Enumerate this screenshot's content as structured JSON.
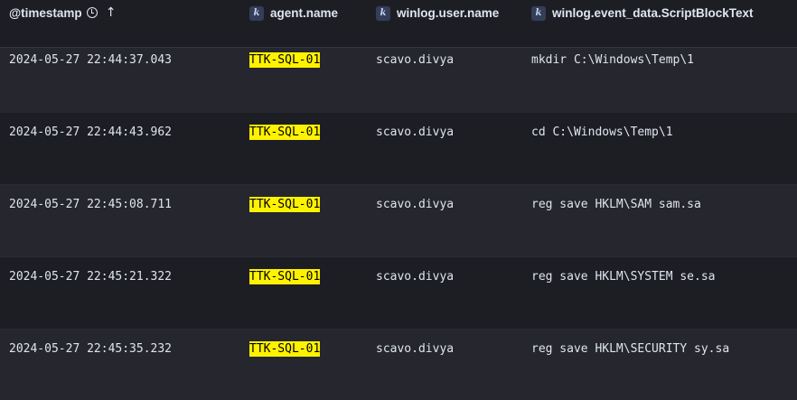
{
  "columns": {
    "timestamp": "@timestamp",
    "agent": "agent.name",
    "user": "winlog.user.name",
    "script": "winlog.event_data.ScriptBlockText",
    "field_type_badge": "k"
  },
  "icons": {
    "sort_time": "clock-icon",
    "sort_direction": "arrow-up-icon",
    "field_type": "keyword-badge"
  },
  "highlight_color": "#fff200",
  "rows": [
    {
      "timestamp": "2024-05-27 22:44:37.043",
      "agent": "TTK-SQL-01",
      "user": "scavo.divya",
      "script": "mkdir C:\\Windows\\Temp\\1"
    },
    {
      "timestamp": "2024-05-27 22:44:43.962",
      "agent": "TTK-SQL-01",
      "user": "scavo.divya",
      "script": "cd C:\\Windows\\Temp\\1"
    },
    {
      "timestamp": "2024-05-27 22:45:08.711",
      "agent": "TTK-SQL-01",
      "user": "scavo.divya",
      "script": "reg save HKLM\\SAM sam.sa"
    },
    {
      "timestamp": "2024-05-27 22:45:21.322",
      "agent": "TTK-SQL-01",
      "user": "scavo.divya",
      "script": "reg save HKLM\\SYSTEM se.sa"
    },
    {
      "timestamp": "2024-05-27 22:45:35.232",
      "agent": "TTK-SQL-01",
      "user": "scavo.divya",
      "script": "reg save HKLM\\SECURITY sy.sa"
    }
  ]
}
